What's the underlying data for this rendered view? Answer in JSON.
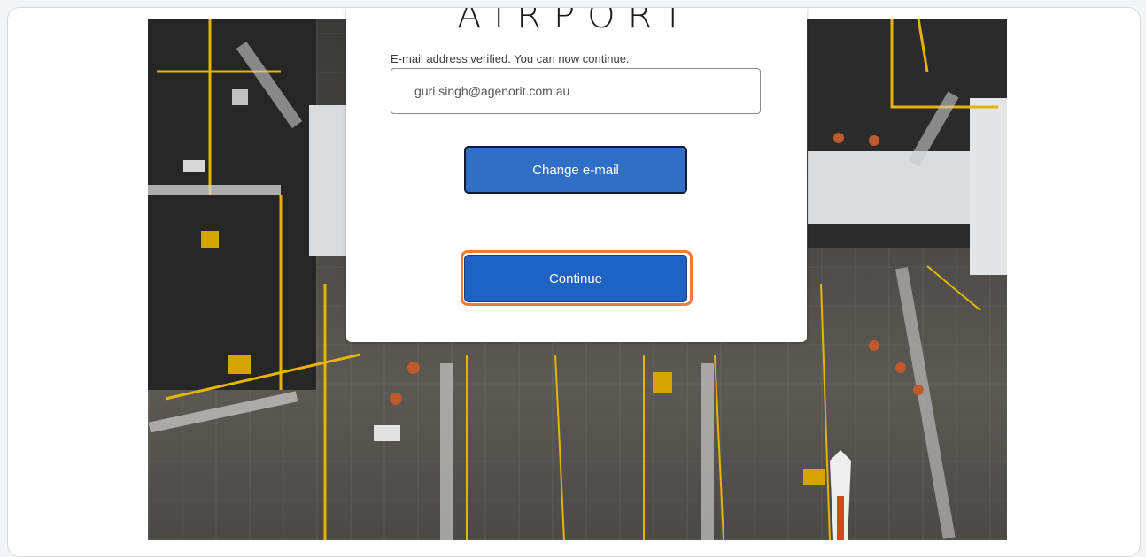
{
  "brand": {
    "text": "AIRPORT"
  },
  "form": {
    "status_message": "E-mail address verified. You can now continue.",
    "email_value": "guri.singh@agenorit.com.au",
    "change_email_label": "Change e-mail",
    "continue_label": "Continue"
  },
  "colors": {
    "primary_button": "#2f6fc6",
    "continue_button": "#1e62c4",
    "highlight_ring": "#f07a3c"
  }
}
